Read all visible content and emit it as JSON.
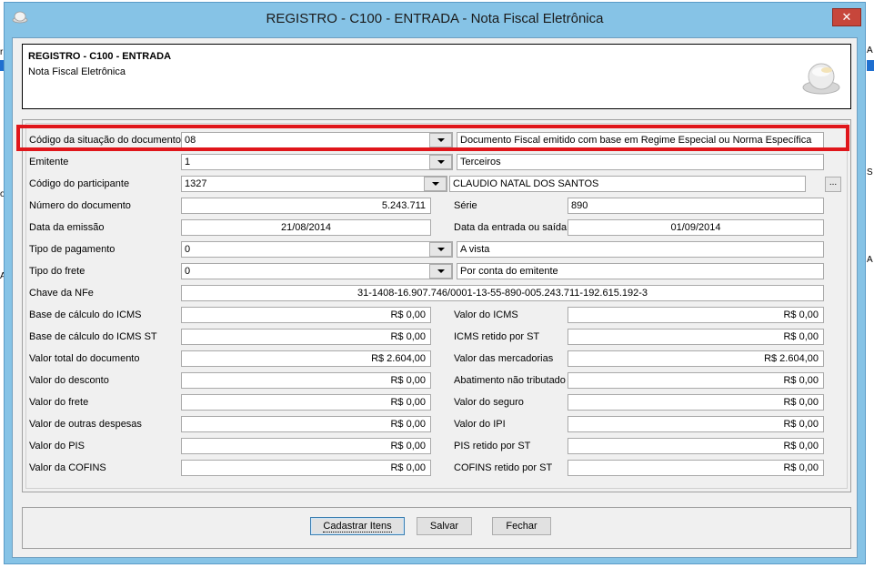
{
  "window": {
    "title": "REGISTRO - C100 - ENTRADA - Nota Fiscal Eletrônica",
    "close_label": "✕"
  },
  "header": {
    "title": "REGISTRO - C100 - ENTRADA",
    "subtitle": "Nota Fiscal Eletrônica"
  },
  "background": {
    "left_fragments": [
      "r",
      "o",
      "A"
    ],
    "right_fragments": [
      "A",
      "S",
      "A"
    ]
  },
  "form": {
    "situacao": {
      "label": "Código da situação do documento",
      "code": "08",
      "description": "Documento Fiscal emitido com base em Regime Especial ou Norma Específica"
    },
    "emitente": {
      "label": "Emitente",
      "code": "1",
      "description": "Terceiros"
    },
    "participante": {
      "label": "Código do participante",
      "code": "1327",
      "description": "CLAUDIO NATAL DOS SANTOS",
      "button_label": "..."
    },
    "numero": {
      "label": "Número do documento",
      "value": "5.243.711"
    },
    "serie": {
      "label": "Série",
      "value": "890"
    },
    "emissao": {
      "label": "Data da emissão",
      "value": "21/08/2014"
    },
    "entrada": {
      "label": "Data da entrada ou saída",
      "value": "01/09/2014"
    },
    "pagamento": {
      "label": "Tipo de pagamento",
      "code": "0",
      "description": "A vista"
    },
    "frete_tipo": {
      "label": "Tipo do frete",
      "code": "0",
      "description": "Por conta do emitente"
    },
    "chave": {
      "label": "Chave da NFe",
      "value": "31-1408-16.907.746/0001-13-55-890-005.243.711-192.615.192-3"
    },
    "values_left": [
      {
        "label": "Base de cálculo do ICMS",
        "value": "R$ 0,00"
      },
      {
        "label": "Base de cálculo do ICMS ST",
        "value": "R$ 0,00"
      },
      {
        "label": "Valor total do documento",
        "value": "R$ 2.604,00"
      },
      {
        "label": "Valor do desconto",
        "value": "R$ 0,00"
      },
      {
        "label": "Valor do frete",
        "value": "R$ 0,00"
      },
      {
        "label": "Valor de outras despesas",
        "value": "R$ 0,00"
      },
      {
        "label": "Valor do PIS",
        "value": "R$ 0,00"
      },
      {
        "label": "Valor da COFINS",
        "value": "R$ 0,00"
      }
    ],
    "values_right": [
      {
        "label": "Valor do ICMS",
        "value": "R$ 0,00"
      },
      {
        "label": "ICMS retido por ST",
        "value": "R$ 0,00"
      },
      {
        "label": "Valor das mercadorias",
        "value": "R$ 2.604,00"
      },
      {
        "label": "Abatimento não tributado",
        "value": "R$ 0,00"
      },
      {
        "label": "Valor do seguro",
        "value": "R$ 0,00"
      },
      {
        "label": "Valor do IPI",
        "value": "R$ 0,00"
      },
      {
        "label": "PIS retido por ST",
        "value": "R$ 0,00"
      },
      {
        "label": "COFINS retido por ST",
        "value": "R$ 0,00"
      }
    ]
  },
  "buttons": {
    "cadastrar": "Cadastrar Itens",
    "salvar": "Salvar",
    "fechar": "Fechar"
  },
  "colors": {
    "titlebar": "#86c3e6",
    "highlight": "#e0161b",
    "close": "#c7463b"
  }
}
